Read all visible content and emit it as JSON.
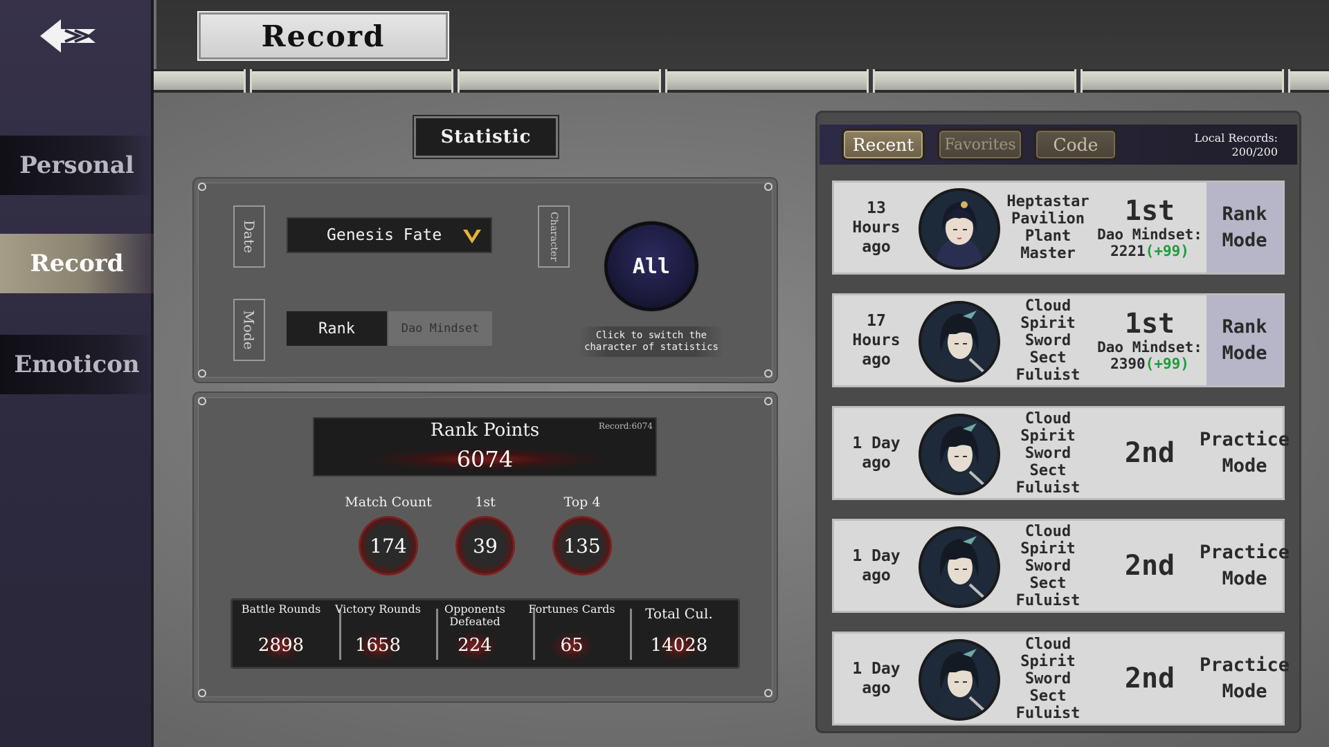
{
  "sidebar": {
    "items": [
      {
        "label": "Personal"
      },
      {
        "label": "Record"
      },
      {
        "label": "Emoticon"
      }
    ]
  },
  "header": {
    "title": "Record"
  },
  "statistic": {
    "title": "Statistic",
    "filters": {
      "date_label": "Date",
      "mode_label": "Mode",
      "character_label": "Character",
      "season_value": "Genesis Fate",
      "mode_options": [
        "Rank",
        "Dao Mindset"
      ],
      "character_button": "All",
      "character_hint": "Click to switch the character of statistics"
    },
    "rank_points": {
      "label": "Rank Points",
      "record": "Record:6074",
      "value": "6074"
    },
    "summary": [
      {
        "label": "Match Count",
        "value": "174"
      },
      {
        "label": "1st",
        "value": "39"
      },
      {
        "label": "Top 4",
        "value": "135"
      }
    ],
    "details": [
      {
        "label": "Battle Rounds",
        "value": "2898"
      },
      {
        "label": "Victory Rounds",
        "value": "1658"
      },
      {
        "label": "Opponents Defeated",
        "value": "224"
      },
      {
        "label": "Fortunes Cards",
        "value": "65"
      },
      {
        "label": "Total Cul.",
        "value": "14028"
      }
    ]
  },
  "records": {
    "tabs": [
      "Recent",
      "Favorites",
      "Code"
    ],
    "local_records_label": "Local Records:",
    "local_records_value": "200/200",
    "items": [
      {
        "time": "13 Hours ago",
        "character": "Heptastar Pavilion Plant Master",
        "placement": "1st",
        "dao_label": "Dao Mindset:",
        "dao_value": "2221",
        "dao_gain": "(+99)",
        "mode": "Rank Mode"
      },
      {
        "time": "17 Hours ago",
        "character": "Cloud Spirit Sword Sect Fuluist",
        "placement": "1st",
        "dao_label": "Dao Mindset:",
        "dao_value": "2390",
        "dao_gain": "(+99)",
        "mode": "Rank Mode"
      },
      {
        "time": "1 Day ago",
        "character": "Cloud Spirit Sword Sect Fuluist",
        "placement": "2nd",
        "mode": "Practice Mode"
      },
      {
        "time": "1 Day ago",
        "character": "Cloud Spirit Sword Sect Fuluist",
        "placement": "2nd",
        "mode": "Practice Mode"
      },
      {
        "time": "1 Day ago",
        "character": "Cloud Spirit Sword Sect Fuluist",
        "placement": "2nd",
        "mode": "Practice Mode"
      }
    ]
  },
  "colors": {
    "sidebar_bg": "#2e2a40",
    "active_nav": "#a69d87",
    "gain_green": "#1f9b3a",
    "rank_mode_bg": "#b6b6c8",
    "accent_red": "#7a1b1b"
  },
  "icons": [
    "back-arrow-icon",
    "chevron-down-icon",
    "character-portrait-icon"
  ]
}
